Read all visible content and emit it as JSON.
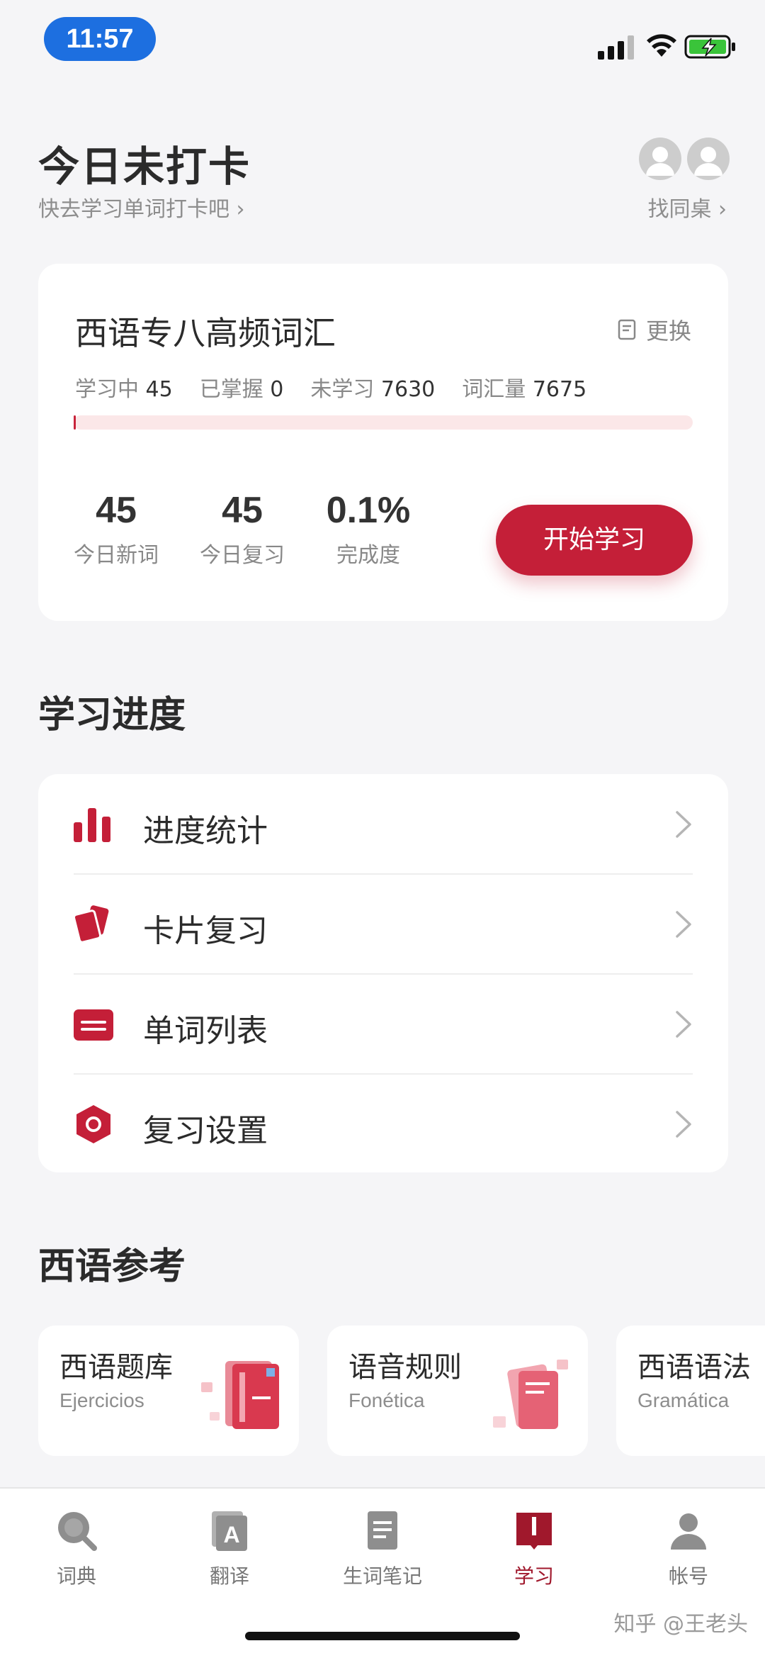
{
  "status_bar": {
    "time": "11:57"
  },
  "header": {
    "title": "今日未打卡",
    "subtitle": "快去学习单词打卡吧 ›",
    "find_desk": "找同桌 ›"
  },
  "wordbook": {
    "title": "西语专八高频词汇",
    "switch_label": "更换",
    "stats": {
      "learning_label": "学习中",
      "learning": "45",
      "mastered_label": "已掌握",
      "mastered": "0",
      "unlearned_label": "未学习",
      "unlearned": "7630",
      "total_label": "词汇量",
      "total": "7675"
    },
    "progress_fraction": 0.001,
    "metrics": [
      {
        "value": "45",
        "label": "今日新词"
      },
      {
        "value": "45",
        "label": "今日复习"
      },
      {
        "value": "0.1%",
        "label": "完成度"
      }
    ],
    "start_button": "开始学习"
  },
  "progress_section": {
    "title": "学习进度",
    "items": [
      {
        "label": "进度统计",
        "icon": "bar-chart-icon"
      },
      {
        "label": "卡片复习",
        "icon": "cards-icon"
      },
      {
        "label": "单词列表",
        "icon": "list-box-icon"
      },
      {
        "label": "复习设置",
        "icon": "hexagon-settings-icon"
      }
    ]
  },
  "reference_section": {
    "title": "西语参考",
    "cards": [
      {
        "title": "西语题库",
        "subtitle": "Ejercicios"
      },
      {
        "title": "语音规则",
        "subtitle": "Fonética"
      },
      {
        "title": "西语语法",
        "subtitle": "Gramática"
      }
    ]
  },
  "tabbar": {
    "items": [
      {
        "label": "词典",
        "icon": "search-icon",
        "active": false
      },
      {
        "label": "翻译",
        "icon": "translate-icon",
        "active": false
      },
      {
        "label": "生词笔记",
        "icon": "notes-icon",
        "active": false
      },
      {
        "label": "学习",
        "icon": "book-icon",
        "active": true
      },
      {
        "label": "帐号",
        "icon": "user-icon",
        "active": false
      }
    ]
  },
  "watermark": "知乎 @王老头",
  "colors": {
    "accent": "#c41f38",
    "active_tab": "#a0182c",
    "background": "#f5f5f7"
  }
}
